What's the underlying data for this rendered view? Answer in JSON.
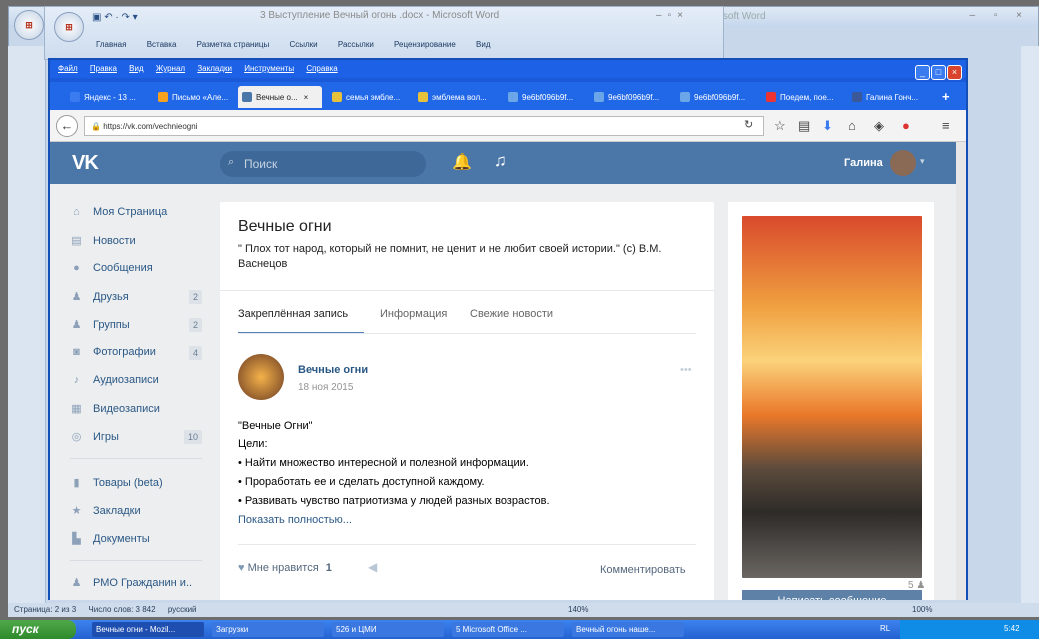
{
  "word_back": {
    "title": "crosoft Word"
  },
  "word_front": {
    "title": "3 Выступление Вечный огонь .docx - Microsoft Word",
    "ribbon": [
      "Главная",
      "Вставка",
      "Разметка страницы",
      "Ссылки",
      "Рассылки",
      "Рецензирование",
      "Вид"
    ]
  },
  "firefox": {
    "menu": [
      "Файл",
      "Правка",
      "Вид",
      "Журнал",
      "Закладки",
      "Инструменты",
      "Справка"
    ],
    "tabs": [
      "Яндекс - 13 ...",
      "Письмо «Але...",
      "Вечные о...",
      "семья эмбле...",
      "эмблема вол...",
      "9e6bf096b9f...",
      "9e6bf096b9f...",
      "9e6bf096b9f...",
      "Поедем, пое...",
      "Галина Гонч..."
    ],
    "url": "https://vk.com/vechnieogni"
  },
  "vk": {
    "search_placeholder": "Поиск",
    "user": "Галина",
    "sidebar": [
      {
        "label": "Моя Страница",
        "count": ""
      },
      {
        "label": "Новости",
        "count": ""
      },
      {
        "label": "Сообщения",
        "count": ""
      },
      {
        "label": "Друзья",
        "count": "2"
      },
      {
        "label": "Группы",
        "count": "2"
      },
      {
        "label": "Фотографии",
        "count": "4"
      },
      {
        "label": "Аудиозаписи",
        "count": ""
      },
      {
        "label": "Видеозаписи",
        "count": ""
      },
      {
        "label": "Игры",
        "count": "10"
      },
      {
        "label": "Товары (beta)",
        "count": ""
      },
      {
        "label": "Закладки",
        "count": ""
      },
      {
        "label": "Документы",
        "count": ""
      },
      {
        "label": "РМО Гражданин и..",
        "count": ""
      }
    ],
    "group": {
      "title": "Вечные огни",
      "status": "\" Плох тот народ, который не помнит, не ценит и не любит своей истории.\" (с) В.М. Васнецов",
      "tabs": [
        "Закреплённая запись",
        "Информация",
        "Свежие новости"
      ],
      "post": {
        "author": "Вечные огни",
        "date": "18 ноя 2015",
        "lines": [
          "\"Вечные Огни\"",
          "Цели:",
          "• Найти множество интересной и полезной информации.",
          "• Проработать ее и сделать доступной каждому.",
          "• Развивать чувство патриотизма у людей разных возрастов."
        ],
        "more": "Показать полностью...",
        "like_label": "Мне нравится",
        "like_count": "1",
        "comment": "Комментировать"
      }
    },
    "photo": {
      "members_count": "5",
      "message_button": "Написать сообщение"
    }
  },
  "word_status": {
    "page": "Страница: 2 из 3",
    "words": "Число слов: 3 842",
    "lang": "русский",
    "zoom_a": "140%",
    "zoom_b": "100%"
  },
  "taskbar": {
    "start": "пуск",
    "items": [
      "Вечные огни - Mozil...",
      "Загрузки",
      "526 и ЦМИ",
      "5 Microsoft Office ...",
      "Вечный огонь наше..."
    ],
    "lang": "RL",
    "time": "5:42"
  }
}
